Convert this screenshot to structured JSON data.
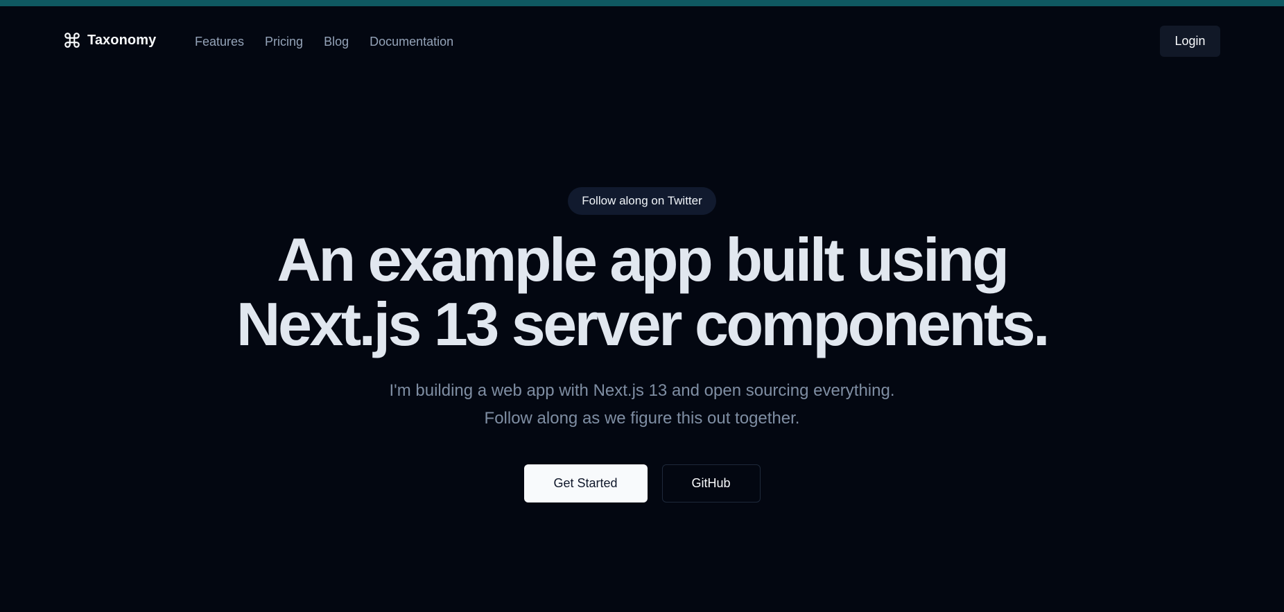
{
  "colors": {
    "background": "#030711",
    "top_strip": "#0f5861",
    "nav_text": "#94a3b8",
    "headline": "#e1e7ef",
    "subtitle": "#7f8ea3",
    "primary_button_bg": "#f8fafc",
    "pill_bg": "#111a2e"
  },
  "header": {
    "brand": {
      "icon": "command-icon",
      "name": "Taxonomy"
    },
    "nav": [
      {
        "label": "Features"
      },
      {
        "label": "Pricing"
      },
      {
        "label": "Blog"
      },
      {
        "label": "Documentation"
      }
    ],
    "login_label": "Login"
  },
  "hero": {
    "pill_label": "Follow along on Twitter",
    "headline": {
      "line1": "An example app built using",
      "line2": "Next.js 13 server components."
    },
    "subtitle": {
      "line1": "I'm building a web app with Next.js 13 and open sourcing everything.",
      "line2": "Follow along as we figure this out together."
    },
    "buttons": {
      "primary": "Get Started",
      "secondary": "GitHub"
    }
  }
}
